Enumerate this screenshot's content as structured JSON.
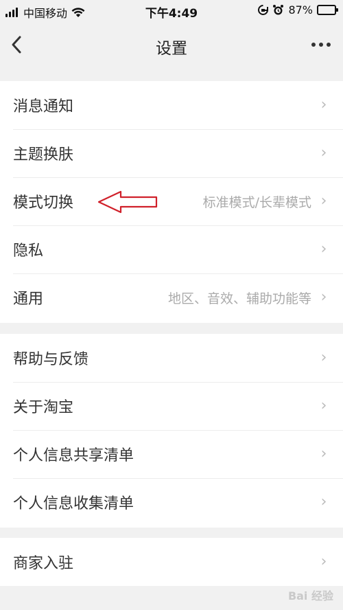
{
  "status": {
    "carrier": "中国移动",
    "time": "下午4:49",
    "battery": "87%",
    "battery_level": 0.87
  },
  "nav": {
    "back_icon": "chevron-left",
    "back_glyph": "‹",
    "title": "设置",
    "more_icon": "more-dots",
    "more_glyph": "•••"
  },
  "group1": [
    {
      "label": "消息通知",
      "value": ""
    },
    {
      "label": "主题换肤",
      "value": ""
    },
    {
      "label": "模式切换",
      "value": "标准模式/长辈模式"
    },
    {
      "label": "隐私",
      "value": ""
    },
    {
      "label": "通用",
      "value": "地区、音效、辅助功能等"
    }
  ],
  "group2": [
    {
      "label": "帮助与反馈"
    },
    {
      "label": "关于淘宝"
    },
    {
      "label": "个人信息共享清单"
    },
    {
      "label": "个人信息收集清单"
    }
  ],
  "group3": [
    {
      "label": "商家入驻"
    }
  ],
  "chevron_glyph": "›",
  "watermark": "Bai 经验",
  "colors": {
    "annotation_arrow": "#d0202a",
    "battery_fill": "#4cd964"
  }
}
